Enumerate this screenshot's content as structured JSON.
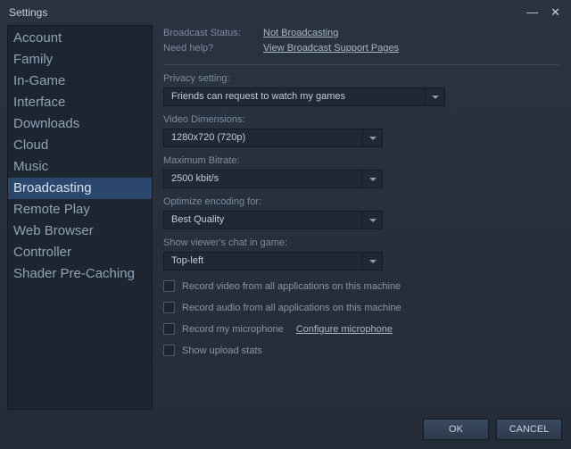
{
  "title": "Settings",
  "sidebar": {
    "items": [
      {
        "label": "Account"
      },
      {
        "label": "Family"
      },
      {
        "label": "In-Game"
      },
      {
        "label": "Interface"
      },
      {
        "label": "Downloads"
      },
      {
        "label": "Cloud"
      },
      {
        "label": "Music"
      },
      {
        "label": "Broadcasting"
      },
      {
        "label": "Remote Play"
      },
      {
        "label": "Web Browser"
      },
      {
        "label": "Controller"
      },
      {
        "label": "Shader Pre-Caching"
      }
    ],
    "active_index": 7
  },
  "status": {
    "broadcast_label": "Broadcast Status:",
    "broadcast_value": "Not Broadcasting",
    "help_label": "Need help?",
    "help_link": "View Broadcast Support Pages"
  },
  "fields": {
    "privacy_label": "Privacy setting:",
    "privacy_value": "Friends can request to watch my games",
    "dimensions_label": "Video Dimensions:",
    "dimensions_value": "1280x720 (720p)",
    "bitrate_label": "Maximum Bitrate:",
    "bitrate_value": "2500 kbit/s",
    "encoding_label": "Optimize encoding for:",
    "encoding_value": "Best Quality",
    "chat_label": "Show viewer's chat in game:",
    "chat_value": "Top-left"
  },
  "checkboxes": {
    "record_video": "Record video from all applications on this machine",
    "record_audio": "Record audio from all applications on this machine",
    "record_mic": "Record my microphone",
    "configure_mic": "Configure microphone",
    "upload_stats": "Show upload stats"
  },
  "footer": {
    "ok": "OK",
    "cancel": "CANCEL"
  }
}
